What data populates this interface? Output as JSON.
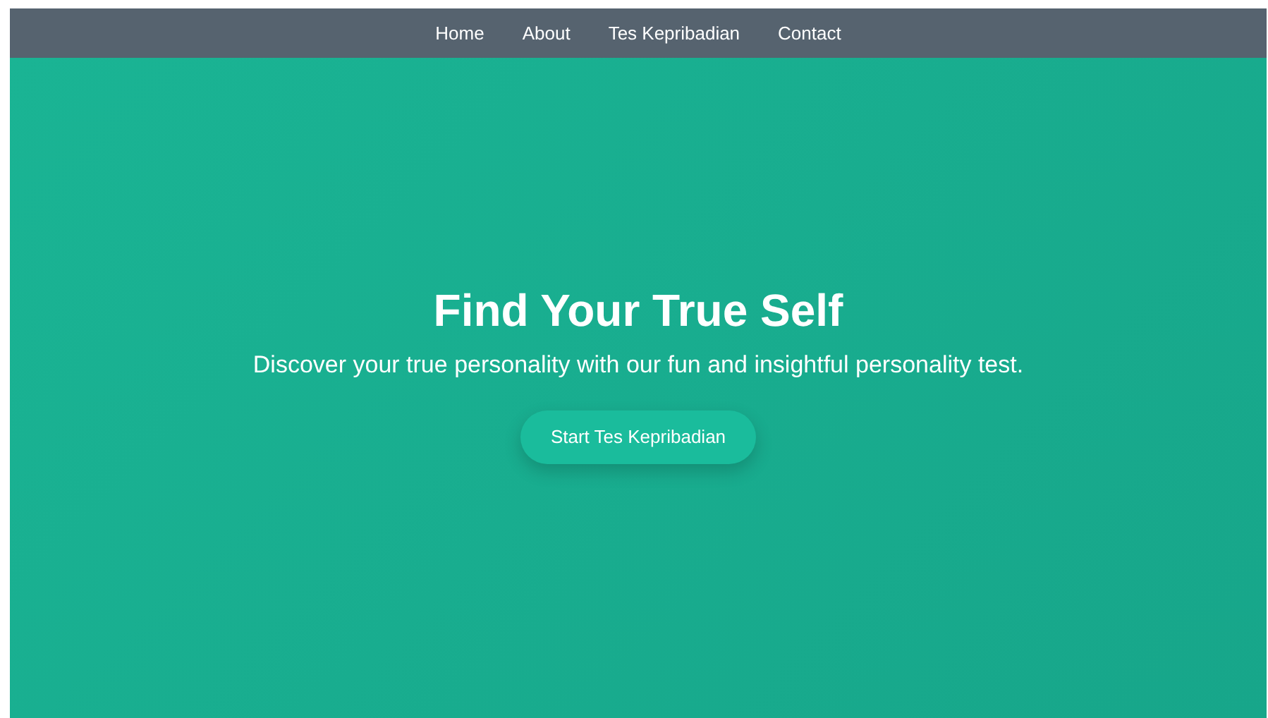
{
  "nav": {
    "items": [
      {
        "label": "Home"
      },
      {
        "label": "About"
      },
      {
        "label": "Tes Kepribadian"
      },
      {
        "label": "Contact"
      }
    ]
  },
  "hero": {
    "title": "Find Your True Self",
    "subtitle": "Discover your true personality with our fun and insightful personality test.",
    "button": "Start Tes Kepribadian"
  }
}
